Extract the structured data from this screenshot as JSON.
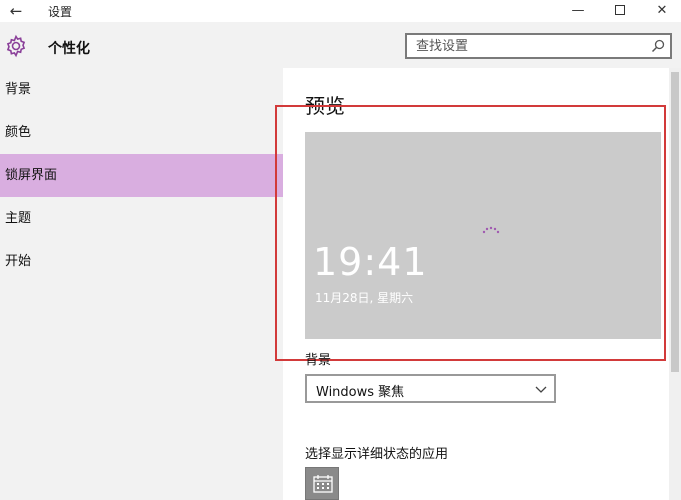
{
  "titlebar": {
    "back_glyph": "←",
    "title": "设置",
    "minimize_glyph": "—",
    "close_glyph": "✕"
  },
  "header": {
    "icon": "gear-icon",
    "title": "个性化",
    "search_placeholder": "查找设置"
  },
  "sidebar": {
    "items": [
      {
        "label": "背景",
        "active": false
      },
      {
        "label": "颜色",
        "active": false
      },
      {
        "label": "锁屏界面",
        "active": true
      },
      {
        "label": "主题",
        "active": false
      },
      {
        "label": "开始",
        "active": false
      }
    ]
  },
  "main": {
    "preview_heading": "预览",
    "lock_time": "19:41",
    "lock_date": "11月28日, 星期六",
    "background_label": "背景",
    "background_value": "Windows 聚焦",
    "detail_app_label": "选择显示详细状态的应用",
    "detail_app_icon": "calendar-icon"
  },
  "colors": {
    "accent": "#d9aee0",
    "highlight_frame": "#d23a3a",
    "preview_bg": "#cbcbcb",
    "sidebar_bg": "#f2f2f2"
  }
}
